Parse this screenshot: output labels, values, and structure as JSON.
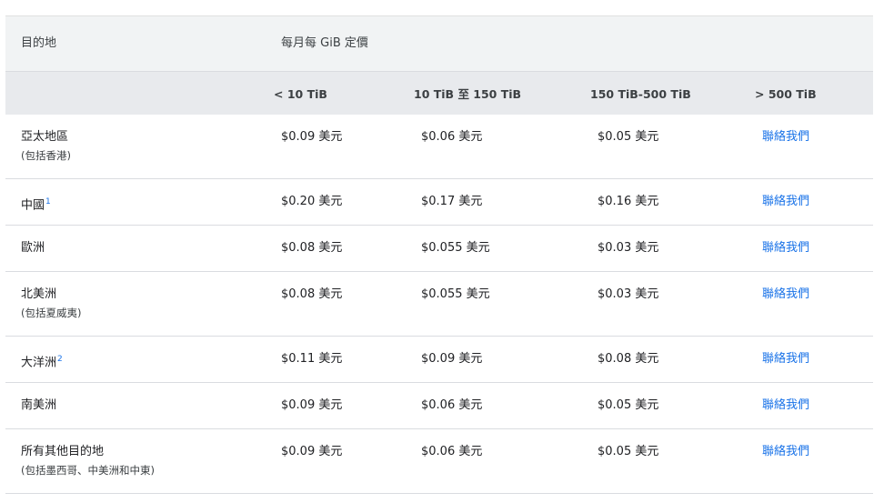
{
  "header": {
    "destination": "目的地",
    "pricing_label": "每月每 GiB 定價"
  },
  "tiers": [
    "< 10 TiB",
    "10 TiB 至 150 TiB",
    "150 TiB-500 TiB",
    "> 500 TiB"
  ],
  "rows": [
    {
      "region": "亞太地區",
      "note": "(包括香港)",
      "footnote": "",
      "p1": "$0.09 美元",
      "p2": "$0.06 美元",
      "p3": "$0.05 美元",
      "contact": "聯絡我們"
    },
    {
      "region": "中國",
      "note": "",
      "footnote": "1",
      "p1": "$0.20 美元",
      "p2": "$0.17 美元",
      "p3": "$0.16 美元",
      "contact": "聯絡我們"
    },
    {
      "region": "歐洲",
      "note": "",
      "footnote": "",
      "p1": "$0.08 美元",
      "p2": "$0.055 美元",
      "p3": "$0.03 美元",
      "contact": "聯絡我們"
    },
    {
      "region": "北美洲",
      "note": "(包括夏威夷)",
      "footnote": "",
      "p1": "$0.08 美元",
      "p2": "$0.055 美元",
      "p3": "$0.03 美元",
      "contact": "聯絡我們"
    },
    {
      "region": "大洋洲",
      "note": "",
      "footnote": "2",
      "p1": "$0.11 美元",
      "p2": "$0.09 美元",
      "p3": "$0.08 美元",
      "contact": "聯絡我們"
    },
    {
      "region": "南美洲",
      "note": "",
      "footnote": "",
      "p1": "$0.09 美元",
      "p2": "$0.06 美元",
      "p3": "$0.05 美元",
      "contact": "聯絡我們"
    },
    {
      "region": "所有其他目的地",
      "note": "(包括墨西哥、中美洲和中東)",
      "footnote": "",
      "p1": "$0.09 美元",
      "p2": "$0.06 美元",
      "p3": "$0.05 美元",
      "contact": "聯絡我們"
    }
  ]
}
